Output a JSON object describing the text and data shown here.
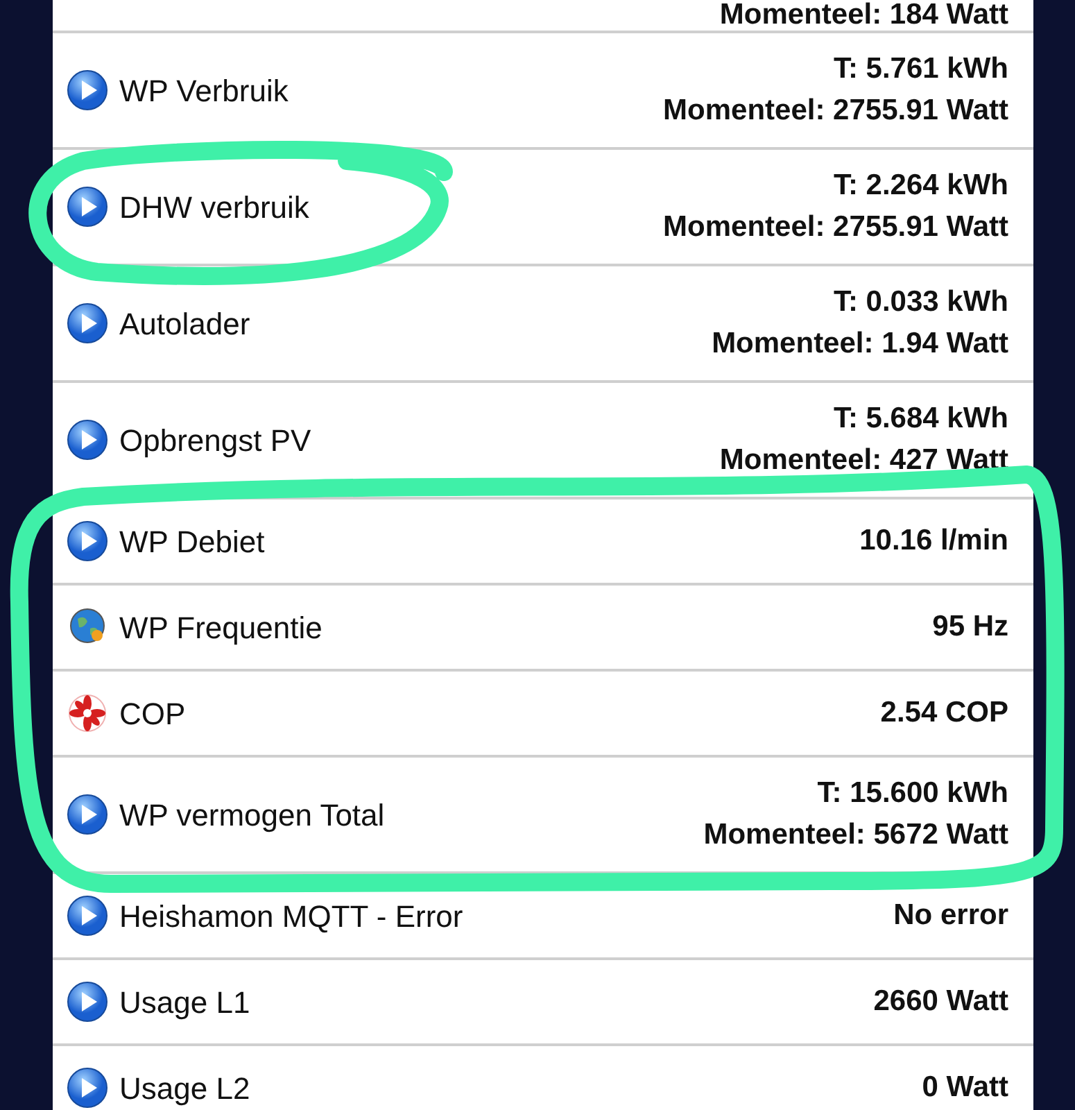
{
  "devices": [
    {
      "kind": "partial",
      "values": [
        "Momenteel: 184 Watt"
      ],
      "circled": false,
      "outlined": false
    },
    {
      "name": "WP Verbruik",
      "kind": "meter",
      "values": [
        "T: 5.761 kWh",
        "Momenteel: 2755.91 Watt"
      ],
      "circled": false,
      "outlined": false
    },
    {
      "name": "DHW verbruik",
      "kind": "meter",
      "values": [
        "T: 2.264 kWh",
        "Momenteel: 2755.91 Watt"
      ],
      "circled": true,
      "outlined": false
    },
    {
      "name": "Autolader",
      "kind": "meter",
      "values": [
        "T: 0.033 kWh",
        "Momenteel: 1.94 Watt"
      ],
      "circled": false,
      "outlined": false
    },
    {
      "name": "Opbrengst PV",
      "kind": "meter",
      "values": [
        "T: 5.684 kWh",
        "Momenteel: 427 Watt"
      ],
      "circled": false,
      "outlined": false
    },
    {
      "name": "WP Debiet",
      "kind": "meter",
      "values": [
        "10.16 l/min"
      ],
      "circled": false,
      "outlined": true
    },
    {
      "name": "WP Frequentie",
      "kind": "frequency",
      "values": [
        "95 Hz"
      ],
      "circled": false,
      "outlined": true
    },
    {
      "name": "COP",
      "kind": "fan",
      "values": [
        "2.54 COP"
      ],
      "circled": false,
      "outlined": true
    },
    {
      "name": "WP vermogen Total",
      "kind": "meter",
      "values": [
        "T: 15.600 kWh",
        "Momenteel: 5672 Watt"
      ],
      "circled": false,
      "outlined": true
    },
    {
      "name": "Heishamon MQTT - Error",
      "kind": "meter",
      "values": [
        "No error"
      ],
      "circled": false,
      "outlined": false
    },
    {
      "name": "Usage L1",
      "kind": "meter",
      "values": [
        "2660 Watt"
      ],
      "circled": false,
      "outlined": false
    },
    {
      "name": "Usage L2",
      "kind": "meter",
      "values": [
        "0 Watt"
      ],
      "circled": false,
      "outlined": false
    }
  ]
}
